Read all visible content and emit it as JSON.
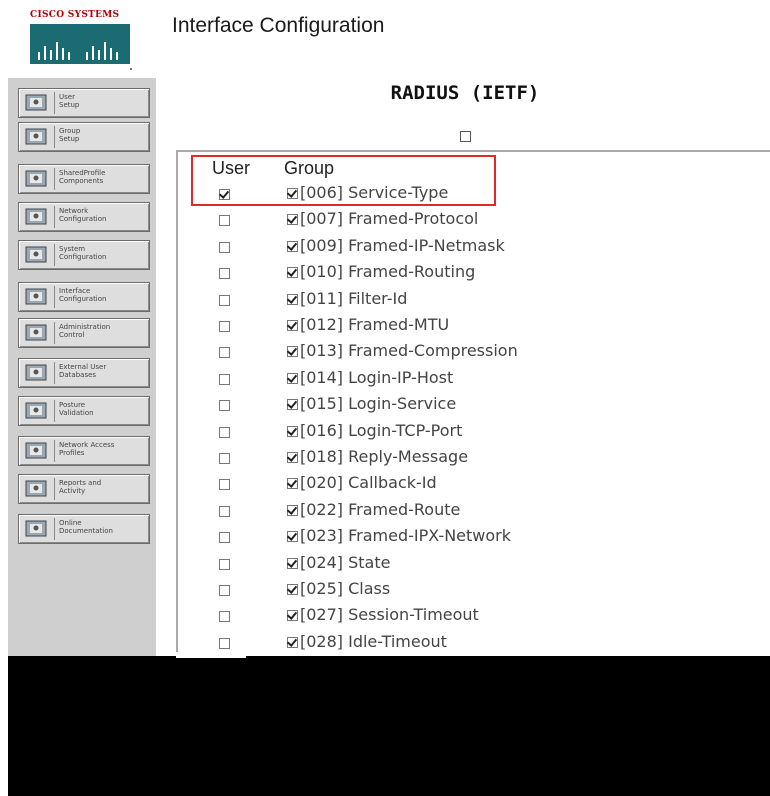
{
  "logo": {
    "brand_text": "Cisco Systems"
  },
  "page_title": "Interface Configuration",
  "section_heading": "RADIUS (IETF)",
  "nav": {
    "items": [
      {
        "label": "User\nSetup",
        "icon": "user-setup-icon"
      },
      {
        "label": "Group\nSetup",
        "icon": "group-setup-icon"
      },
      {
        "label": "SharedProfile\nComponents",
        "icon": "shared-profile-icon"
      },
      {
        "label": "Network\nConfiguration",
        "icon": "network-config-icon"
      },
      {
        "label": "System\nConfiguration",
        "icon": "system-config-icon"
      },
      {
        "label": "Interface\nConfiguration",
        "icon": "interface-config-icon"
      },
      {
        "label": "Administration\nControl",
        "icon": "admin-control-icon"
      },
      {
        "label": "External User\nDatabases",
        "icon": "external-db-icon"
      },
      {
        "label": "Posture\nValidation",
        "icon": "posture-icon"
      },
      {
        "label": "Network Access\nProfiles",
        "icon": "nap-icon"
      },
      {
        "label": "Reports and\nActivity",
        "icon": "reports-icon"
      },
      {
        "label": "Online\nDocumentation",
        "icon": "docs-icon"
      }
    ]
  },
  "table": {
    "col_user": "User",
    "col_group": "Group",
    "rows": [
      {
        "attr": "[006] Service-Type",
        "user": true,
        "group": true
      },
      {
        "attr": "[007] Framed-Protocol",
        "user": false,
        "group": true
      },
      {
        "attr": "[009] Framed-IP-Netmask",
        "user": false,
        "group": true
      },
      {
        "attr": "[010] Framed-Routing",
        "user": false,
        "group": true
      },
      {
        "attr": "[011] Filter-Id",
        "user": false,
        "group": true
      },
      {
        "attr": "[012] Framed-MTU",
        "user": false,
        "group": true
      },
      {
        "attr": "[013] Framed-Compression",
        "user": false,
        "group": true
      },
      {
        "attr": "[014] Login-IP-Host",
        "user": false,
        "group": true
      },
      {
        "attr": "[015] Login-Service",
        "user": false,
        "group": true
      },
      {
        "attr": "[016] Login-TCP-Port",
        "user": false,
        "group": true
      },
      {
        "attr": "[018] Reply-Message",
        "user": false,
        "group": true
      },
      {
        "attr": "[020] Callback-Id",
        "user": false,
        "group": true
      },
      {
        "attr": "[022] Framed-Route",
        "user": false,
        "group": true
      },
      {
        "attr": "[023] Framed-IPX-Network",
        "user": false,
        "group": true
      },
      {
        "attr": "[024] State",
        "user": false,
        "group": true
      },
      {
        "attr": "[025] Class",
        "user": false,
        "group": true
      },
      {
        "attr": "[027] Session-Timeout",
        "user": false,
        "group": true
      },
      {
        "attr": "[028] Idle-Timeout",
        "user": false,
        "group": true
      }
    ]
  },
  "colors": {
    "highlight": "#e02a2a",
    "nav_bg": "#cfcfcf",
    "logo_red": "#b00000"
  }
}
